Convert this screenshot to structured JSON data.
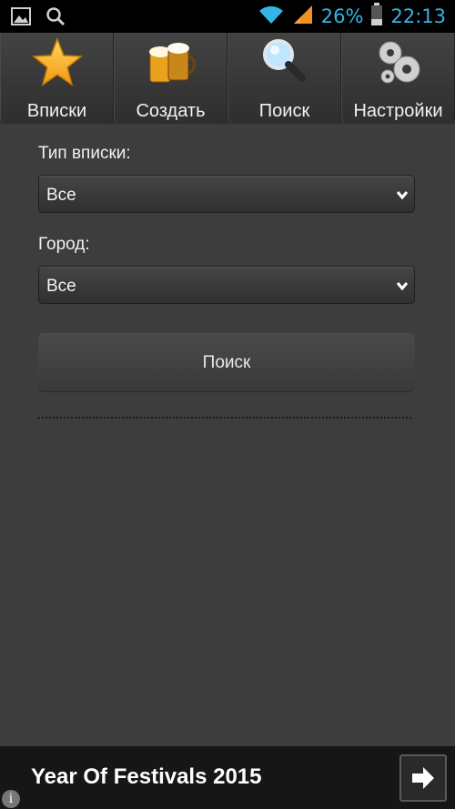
{
  "status_bar": {
    "battery_percent": "26%",
    "time": "22:13",
    "accent_color": "#33b5e5",
    "icons": [
      "gallery-icon",
      "search-icon",
      "wifi-icon",
      "signal-icon",
      "battery-icon"
    ]
  },
  "tabs": [
    {
      "label": "Вписки",
      "icon": "star-icon"
    },
    {
      "label": "Создать",
      "icon": "beer-icon"
    },
    {
      "label": "Поиск",
      "icon": "magnifier-icon"
    },
    {
      "label": "Настройки",
      "icon": "gears-icon"
    }
  ],
  "form": {
    "type_label": "Тип вписки:",
    "type_value": "Все",
    "city_label": "Город:",
    "city_value": "Все",
    "search_button": "Поиск"
  },
  "footer": {
    "title": "Year Of Festivals 2015",
    "info_glyph": "i"
  }
}
